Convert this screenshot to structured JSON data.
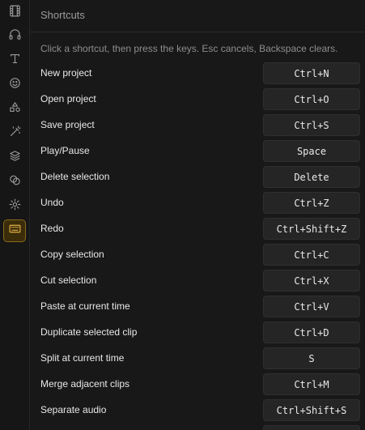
{
  "header": {
    "title": "Shortcuts"
  },
  "hint": "Click a shortcut, then press the keys. Esc cancels, Backspace clears.",
  "sidebar": {
    "items": [
      {
        "icon": "film-icon"
      },
      {
        "icon": "headphones-icon"
      },
      {
        "icon": "text-icon"
      },
      {
        "icon": "smiley-icon"
      },
      {
        "icon": "shapes-icon"
      },
      {
        "icon": "magic-wand-icon"
      },
      {
        "icon": "layers-icon"
      },
      {
        "icon": "overlap-icon"
      },
      {
        "icon": "gear-icon"
      },
      {
        "icon": "keyboard-icon",
        "active": true
      }
    ]
  },
  "shortcuts": [
    {
      "label": "New project",
      "keys": "Ctrl+N"
    },
    {
      "label": "Open project",
      "keys": "Ctrl+O"
    },
    {
      "label": "Save project",
      "keys": "Ctrl+S"
    },
    {
      "label": "Play/Pause",
      "keys": "Space"
    },
    {
      "label": "Delete selection",
      "keys": "Delete"
    },
    {
      "label": "Undo",
      "keys": "Ctrl+Z"
    },
    {
      "label": "Redo",
      "keys": "Ctrl+Shift+Z"
    },
    {
      "label": "Copy selection",
      "keys": "Ctrl+C"
    },
    {
      "label": "Cut selection",
      "keys": "Ctrl+X"
    },
    {
      "label": "Paste at current time",
      "keys": "Ctrl+V"
    },
    {
      "label": "Duplicate selected clip",
      "keys": "Ctrl+D"
    },
    {
      "label": "Split at current time",
      "keys": "S"
    },
    {
      "label": "Merge adjacent clips",
      "keys": "Ctrl+M"
    },
    {
      "label": "Separate audio",
      "keys": "Ctrl+Shift+S"
    },
    {
      "label": "",
      "keys": ""
    }
  ],
  "colors": {
    "accent": "#e4b245",
    "background": "#181818"
  }
}
